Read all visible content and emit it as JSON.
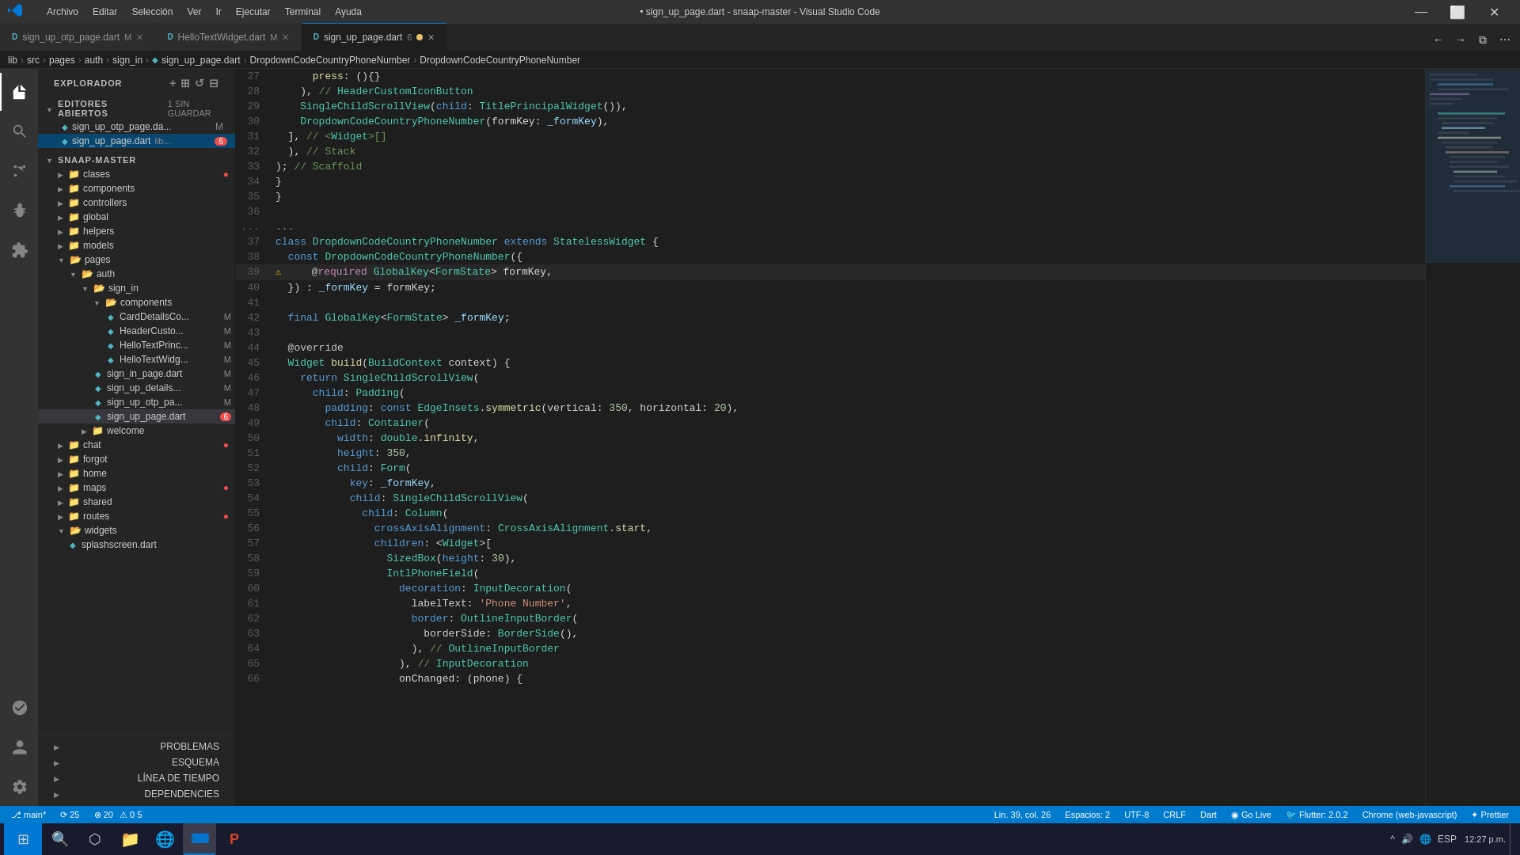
{
  "titleBar": {
    "title": "• sign_up_page.dart - snaap-master - Visual Studio Code",
    "vscodeLogo": "VS",
    "menus": [
      "Archivo",
      "Editar",
      "Selección",
      "Ver",
      "Ir",
      "Ejecutar",
      "Terminal",
      "Ayuda"
    ],
    "winMin": "—",
    "winMax": "⬜",
    "winClose": "✕"
  },
  "tabs": [
    {
      "id": "tab1",
      "label": "sign_up_otp_page.dart",
      "modifier": "M",
      "active": false
    },
    {
      "id": "tab2",
      "label": "HelloTextWidget.dart",
      "modifier": "M",
      "active": false
    },
    {
      "id": "tab3",
      "label": "sign_up_page.dart",
      "modifier": "6",
      "active": true,
      "dirty": true
    }
  ],
  "breadcrumb": {
    "parts": [
      "lib",
      "src",
      "pages",
      "auth",
      "sign_in",
      "sign_up_page.dart",
      "DropdownCodeCountryPhoneNumber",
      "DropdownCodeCountryPhoneNumber"
    ]
  },
  "sidebar": {
    "explorerTitle": "EXPLORADOR",
    "openEditorsLabel": "EDITORES ABIERTOS",
    "openEditorsSuffix": "1 SIN GUARDAR",
    "openEditors": [
      {
        "name": "sign_up_otp_page.da...",
        "badge": "M"
      },
      {
        "name": "sign_up_page.dart",
        "badge": "lib...",
        "badgeNum": "6",
        "active": true
      }
    ],
    "projectName": "SNAAP-MASTER",
    "tree": [
      {
        "type": "folder",
        "name": "clases",
        "indent": 1,
        "badge": ""
      },
      {
        "type": "folder",
        "name": "components",
        "indent": 1,
        "badge": ""
      },
      {
        "type": "folder",
        "name": "controllers",
        "indent": 1,
        "badge": ""
      },
      {
        "type": "folder",
        "name": "global",
        "indent": 1,
        "badge": ""
      },
      {
        "type": "folder",
        "name": "helpers",
        "indent": 1,
        "badge": ""
      },
      {
        "type": "folder",
        "name": "models",
        "indent": 1,
        "badge": ""
      },
      {
        "type": "folder",
        "name": "pages",
        "indent": 1,
        "open": true,
        "badge": ""
      },
      {
        "type": "folder",
        "name": "auth",
        "indent": 2,
        "open": true,
        "badge": ""
      },
      {
        "type": "folder",
        "name": "sign_in",
        "indent": 3,
        "open": true,
        "badge": ""
      },
      {
        "type": "folder",
        "name": "components",
        "indent": 4,
        "open": true,
        "badge": ""
      },
      {
        "type": "file",
        "name": "CardDetailsC0...",
        "indent": 5,
        "badge": "M"
      },
      {
        "type": "file",
        "name": "HeaderCusto...",
        "indent": 5,
        "badge": "M"
      },
      {
        "type": "file",
        "name": "HelloTextPrinc...",
        "indent": 5,
        "badge": "M"
      },
      {
        "type": "file",
        "name": "HelloTextWidg...",
        "indent": 5,
        "badge": "M"
      },
      {
        "type": "file",
        "name": "sign_in_page.dart",
        "indent": 4,
        "badge": "M"
      },
      {
        "type": "file",
        "name": "sign_up_details...",
        "indent": 4,
        "badge": "M"
      },
      {
        "type": "file",
        "name": "sign_up_otp_pa...",
        "indent": 4,
        "badge": "M"
      },
      {
        "type": "file",
        "name": "sign_up_page.dart",
        "indent": 4,
        "badge": "6",
        "active": true
      },
      {
        "type": "folder",
        "name": "welcome",
        "indent": 3,
        "badge": ""
      },
      {
        "type": "folder",
        "name": "chat",
        "indent": 1,
        "badge": "●"
      },
      {
        "type": "folder",
        "name": "forgot",
        "indent": 1,
        "badge": ""
      },
      {
        "type": "folder",
        "name": "home",
        "indent": 1,
        "badge": ""
      },
      {
        "type": "folder",
        "name": "maps",
        "indent": 1,
        "badge": "●"
      },
      {
        "type": "folder",
        "name": "shared",
        "indent": 1,
        "badge": ""
      },
      {
        "type": "folder",
        "name": "routes",
        "indent": 1,
        "badge": "●"
      },
      {
        "type": "folder",
        "name": "widgets",
        "indent": 1,
        "open": true,
        "badge": ""
      },
      {
        "type": "file",
        "name": "splashscreen.dart",
        "indent": 2,
        "badge": ""
      }
    ],
    "bottomSections": [
      {
        "label": "PROBLEMAS",
        "badge": ""
      },
      {
        "label": "ESQUEMA",
        "badge": ""
      },
      {
        "label": "LÍNEA DE TIEMPO",
        "badge": ""
      },
      {
        "label": "DEPENDENCIES",
        "badge": ""
      }
    ]
  },
  "editor": {
    "lines": [
      {
        "num": "27",
        "content": "      press: (){}"
      },
      {
        "num": "28",
        "content": "    ), // HeaderCustomIconButton"
      },
      {
        "num": "29",
        "content": "    SingleChildScrollView(child: TitlePrincipalWidget()),"
      },
      {
        "num": "30",
        "content": "    DropdownCodeCountryPhoneNumber(formKey: _formKey),"
      },
      {
        "num": "31",
        "content": "  ], // <Widget>[]"
      },
      {
        "num": "32",
        "content": "  ), // Stack"
      },
      {
        "num": "33",
        "content": "); // Scaffold"
      },
      {
        "num": "34",
        "content": "}"
      },
      {
        "num": "35",
        "content": "}"
      },
      {
        "num": "36",
        "content": ""
      },
      {
        "num": "...",
        "content": "..."
      },
      {
        "num": "37",
        "content": "class DropdownCodeCountryPhoneNumber extends StatelessWidget {"
      },
      {
        "num": "38",
        "content": "  const DropdownCodeCountryPhoneNumber({"
      },
      {
        "num": "39",
        "content": "    @required GlobalKey<FormState> formKey,",
        "warning": true
      },
      {
        "num": "40",
        "content": "  }) : _formKey = formKey;"
      },
      {
        "num": "41",
        "content": ""
      },
      {
        "num": "42",
        "content": "  final GlobalKey<FormState> _formKey;"
      },
      {
        "num": "43",
        "content": ""
      },
      {
        "num": "44",
        "content": "  @override"
      },
      {
        "num": "45",
        "content": "  Widget build(BuildContext context) {"
      },
      {
        "num": "46",
        "content": "    return SingleChildScrollView("
      },
      {
        "num": "47",
        "content": "      child: Padding("
      },
      {
        "num": "48",
        "content": "        padding: const EdgeInsets.symmetric(vertical: 350, horizontal: 20),"
      },
      {
        "num": "49",
        "content": "        child: Container("
      },
      {
        "num": "50",
        "content": "          width: double.infinity,"
      },
      {
        "num": "51",
        "content": "          height: 350,"
      },
      {
        "num": "52",
        "content": "          child: Form("
      },
      {
        "num": "53",
        "content": "            key: _formKey,"
      },
      {
        "num": "54",
        "content": "            child: SingleChildScrollView("
      },
      {
        "num": "55",
        "content": "              child: Column("
      },
      {
        "num": "56",
        "content": "                crossAxisAlignment: CrossAxisAlignment.start,"
      },
      {
        "num": "57",
        "content": "                children: <Widget>["
      },
      {
        "num": "58",
        "content": "                  SizedBox(height: 30),"
      },
      {
        "num": "59",
        "content": "                  IntlPhoneField("
      },
      {
        "num": "60",
        "content": "                    decoration: InputDecoration("
      },
      {
        "num": "61",
        "content": "                      labelText: 'Phone Number',"
      },
      {
        "num": "62",
        "content": "                      border: OutlineInputBorder("
      },
      {
        "num": "63",
        "content": "                        borderSide: BorderSide(),"
      },
      {
        "num": "64",
        "content": "                      ), // OutlineInputBorder"
      },
      {
        "num": "65",
        "content": "                    ), // InputDecoration"
      },
      {
        "num": "66",
        "content": "                    onChanged: (phone) {"
      }
    ]
  },
  "statusBar": {
    "left": [
      {
        "id": "branch",
        "text": "⎇ main*"
      },
      {
        "id": "sync",
        "text": "⟳ 25"
      },
      {
        "id": "errors",
        "text": "⊘ 20 ⚠ 0 5"
      }
    ],
    "right": [
      {
        "id": "position",
        "text": "Lin. 39, col. 26"
      },
      {
        "id": "spaces",
        "text": "Espacios: 2"
      },
      {
        "id": "encoding",
        "text": "UTF-8"
      },
      {
        "id": "lineending",
        "text": "CRLF"
      },
      {
        "id": "language",
        "text": "Dart"
      },
      {
        "id": "golive",
        "text": "◉ Go Live"
      },
      {
        "id": "flutter",
        "text": "Flutter: 2.0.2"
      },
      {
        "id": "chrome",
        "text": "Chrome (web-javascript)"
      },
      {
        "id": "prettier",
        "text": "✦ Prettier"
      }
    ]
  },
  "taskbar": {
    "startIcon": "⊞",
    "apps": [
      {
        "id": "search",
        "icon": "🔍"
      },
      {
        "id": "files",
        "icon": "📁"
      },
      {
        "id": "edge",
        "icon": "🌐"
      },
      {
        "id": "vscode",
        "icon": "VS",
        "active": true
      },
      {
        "id": "powerpoint",
        "icon": "P"
      }
    ],
    "systemTray": {
      "lang": "ESP",
      "time": "12:27 p.m.",
      "icons": [
        "^",
        "🔊",
        "🌐"
      ]
    }
  },
  "activityBar": {
    "icons": [
      {
        "id": "explorer",
        "symbol": "📄",
        "active": true
      },
      {
        "id": "search",
        "symbol": "🔍"
      },
      {
        "id": "git",
        "symbol": "⎇"
      },
      {
        "id": "debug",
        "symbol": "▶"
      },
      {
        "id": "extensions",
        "symbol": "⬛"
      },
      {
        "id": "remote",
        "symbol": "⟳",
        "bottom": false
      },
      {
        "id": "accounts",
        "symbol": "👤",
        "bottom": true
      },
      {
        "id": "settings",
        "symbol": "⚙",
        "bottom": true
      }
    ]
  }
}
